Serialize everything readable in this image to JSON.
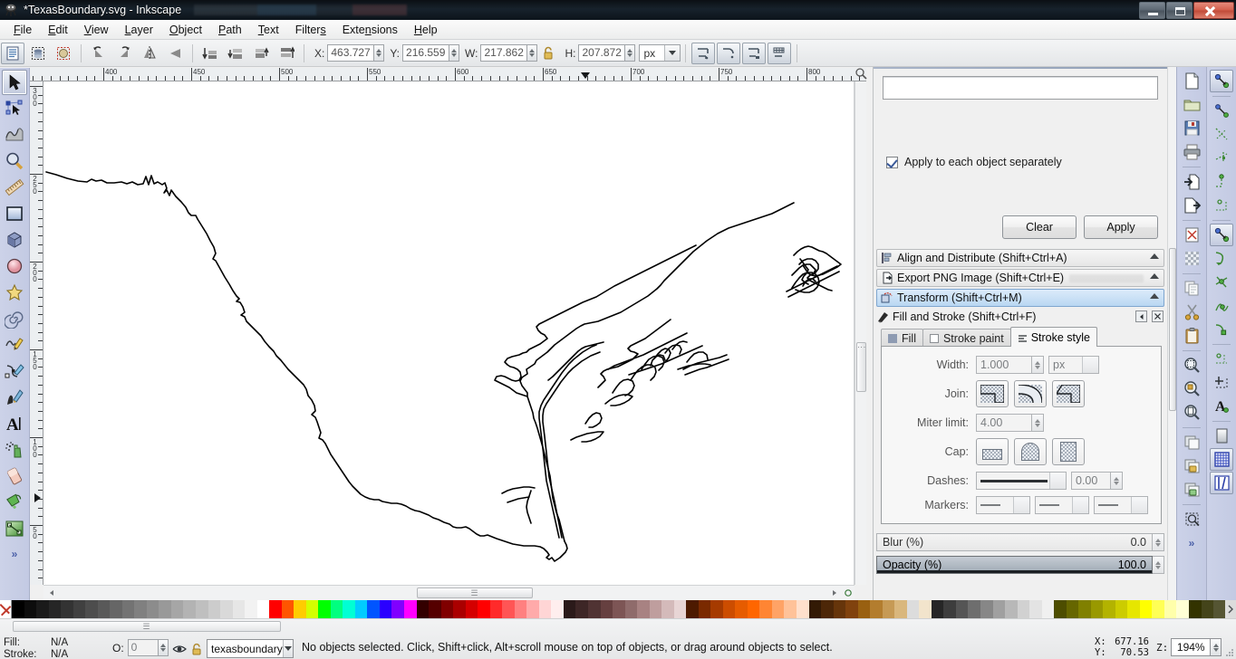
{
  "window": {
    "title": "*TexasBoundary.svg - Inkscape",
    "app_icon": "inkscape-logo-icon",
    "controls": {
      "minimize": "minimize-button",
      "restore": "restore-button",
      "close": "close-button"
    }
  },
  "menubar": {
    "items": [
      {
        "label": "File",
        "mnemonic": "F"
      },
      {
        "label": "Edit",
        "mnemonic": "E"
      },
      {
        "label": "View",
        "mnemonic": "V"
      },
      {
        "label": "Layer",
        "mnemonic": "L"
      },
      {
        "label": "Object",
        "mnemonic": "O"
      },
      {
        "label": "Path",
        "mnemonic": "P"
      },
      {
        "label": "Text",
        "mnemonic": "T"
      },
      {
        "label": "Filters",
        "mnemonic": "s"
      },
      {
        "label": "Extensions",
        "mnemonic": "n"
      },
      {
        "label": "Help",
        "mnemonic": "H"
      }
    ]
  },
  "selector_toolbar": {
    "buttons": [
      {
        "name": "select-all-icon",
        "title": "Select All"
      },
      {
        "name": "select-all-in-all-layers-icon",
        "title": "Select All in All Layers"
      },
      {
        "name": "deselect-icon",
        "title": "Deselect"
      },
      {
        "name": "rotate-ccw-icon",
        "title": "Rotate 90 CCW"
      },
      {
        "name": "rotate-cw-icon",
        "title": "Rotate 90 CW"
      },
      {
        "name": "flip-horizontal-icon",
        "title": "Flip Horizontal"
      },
      {
        "name": "flip-vertical-icon",
        "title": "Flip Vertical"
      },
      {
        "name": "lower-to-bottom-icon",
        "title": "Lower to Bottom"
      },
      {
        "name": "lower-one-step-icon",
        "title": "Lower One Step"
      },
      {
        "name": "raise-one-step-icon",
        "title": "Raise One Step"
      },
      {
        "name": "raise-to-top-icon",
        "title": "Raise to Top"
      }
    ],
    "x_label": "X:",
    "x_value": "463.727",
    "y_label": "Y:",
    "y_value": "216.559",
    "w_label": "W:",
    "w_value": "217.862",
    "h_label": "H:",
    "h_value": "207.872",
    "lock_icon": "lock-ratio-icon",
    "unit": "px",
    "affect_buttons": [
      {
        "name": "affect-stroke-width-icon"
      },
      {
        "name": "affect-rounded-corners-icon"
      },
      {
        "name": "affect-gradients-icon"
      },
      {
        "name": "affect-patterns-icon"
      }
    ]
  },
  "toolbox": {
    "tools": [
      {
        "name": "selector-tool",
        "label": "Selector",
        "active": true
      },
      {
        "name": "node-tool",
        "label": "Node editor",
        "active": false
      },
      {
        "name": "tweak-tool",
        "label": "Tweak",
        "active": false
      },
      {
        "name": "zoom-tool",
        "label": "Zoom",
        "active": false
      },
      {
        "name": "measure-tool",
        "label": "Measure",
        "active": false
      },
      {
        "name": "rectangle-tool",
        "label": "Rectangle",
        "active": false
      },
      {
        "name": "box3d-tool",
        "label": "3D Box",
        "active": false
      },
      {
        "name": "ellipse-tool",
        "label": "Ellipse",
        "active": false
      },
      {
        "name": "star-tool",
        "label": "Star",
        "active": false
      },
      {
        "name": "spiral-tool",
        "label": "Spiral",
        "active": false
      },
      {
        "name": "pencil-tool",
        "label": "Pencil",
        "active": false
      },
      {
        "name": "bezier-tool",
        "label": "Bezier",
        "active": false
      },
      {
        "name": "calligraphy-tool",
        "label": "Calligraphy",
        "active": false
      },
      {
        "name": "text-tool",
        "label": "Text",
        "active": false
      },
      {
        "name": "spray-tool",
        "label": "Spray",
        "active": false
      },
      {
        "name": "eraser-tool",
        "label": "Eraser",
        "active": false
      },
      {
        "name": "paint-bucket-tool",
        "label": "Paint Bucket",
        "active": false
      },
      {
        "name": "gradient-tool",
        "label": "Gradient",
        "active": false
      }
    ],
    "overflow_label": "»"
  },
  "rulers": {
    "unit": "px",
    "horizontal_labels": [
      "400",
      "450",
      "500",
      "550",
      "600",
      "650",
      "700",
      "750",
      "800"
    ],
    "vertical_labels": [
      "300",
      "250",
      "200",
      "150",
      "100",
      "50"
    ],
    "h_marker_value": "677",
    "v_marker_value": "70"
  },
  "canvas": {
    "document_name": "TexasBoundary.svg",
    "shape_name": "texas-boundary-path",
    "stroke_color": "#000000",
    "fill_color": "none",
    "background": "#ffffff"
  },
  "dock": {
    "transform_panel": {
      "apply_each_label": "Apply to each object separately",
      "apply_each_checked": true,
      "clear_label": "Clear",
      "apply_label": "Apply"
    },
    "collapsed_dialogs": [
      {
        "label": "Align and Distribute (Shift+Ctrl+A)",
        "icon": "align-icon",
        "active": false
      },
      {
        "label": "Export PNG Image (Shift+Ctrl+E)",
        "icon": "export-png-icon",
        "active": false
      },
      {
        "label": "Transform (Shift+Ctrl+M)",
        "icon": "transform-icon",
        "active": true
      }
    ],
    "fill_and_stroke": {
      "title": "Fill and Stroke (Shift+Ctrl+F)",
      "icon": "fill-stroke-icon",
      "dock_button": "dock-float-button",
      "close_button": "close-dialog-button",
      "tabs": [
        {
          "label": "Fill",
          "name": "tab-fill",
          "selected": false,
          "swatch": "#8e9bb2"
        },
        {
          "label": "Stroke paint",
          "name": "tab-stroke-paint",
          "selected": false,
          "swatch": "#ffffff"
        },
        {
          "label": "Stroke style",
          "name": "tab-stroke-style",
          "selected": true,
          "swatch": "lines"
        }
      ],
      "stroke_style": {
        "width_label": "Width:",
        "width_value": "1.000",
        "width_unit": "px",
        "join_label": "Join:",
        "join_options": [
          "miter-join",
          "round-join",
          "bevel-join"
        ],
        "miter_label": "Miter limit:",
        "miter_value": "4.00",
        "cap_label": "Cap:",
        "cap_options": [
          "butt-cap",
          "round-cap",
          "square-cap"
        ],
        "dashes_label": "Dashes:",
        "dashes_offset": "0.00",
        "markers_label": "Markers:",
        "markers": [
          "none",
          "none",
          "none"
        ]
      },
      "blur_label": "Blur (%)",
      "blur_value": "0.0",
      "opacity_label": "Opacity (%)",
      "opacity_value": "100.0"
    }
  },
  "commands_bar": {
    "buttons": [
      {
        "name": "new-document-icon"
      },
      {
        "name": "open-document-icon"
      },
      {
        "name": "save-document-icon"
      },
      {
        "name": "print-document-icon"
      },
      {
        "name": "import-icon"
      },
      {
        "name": "export-icon"
      },
      {
        "name": "undo-history-icon"
      },
      {
        "name": "paste-in-place-icon"
      },
      {
        "name": "duplicate-icon"
      },
      {
        "name": "cut-icon"
      },
      {
        "name": "clipboard-icon"
      },
      {
        "name": "zoom-selection-icon"
      },
      {
        "name": "zoom-drawing-icon"
      },
      {
        "name": "zoom-page-icon"
      },
      {
        "name": "duplicate-object-icon"
      },
      {
        "name": "group-icon"
      },
      {
        "name": "ungroup-icon"
      },
      {
        "name": "object-properties-icon"
      }
    ],
    "overflow_label": "»"
  },
  "snap_bar": {
    "buttons": [
      {
        "name": "enable-snapping-icon",
        "active": true
      },
      {
        "name": "snap-bounding-box-icon",
        "active": false
      },
      {
        "name": "snap-bbox-edges-icon",
        "active": false
      },
      {
        "name": "snap-bbox-corners-icon",
        "active": false
      },
      {
        "name": "snap-bbox-edge-midpoints-icon",
        "active": false
      },
      {
        "name": "snap-bbox-centers-icon",
        "active": false
      },
      {
        "name": "snap-nodes-paths-icon",
        "active": true
      },
      {
        "name": "snap-paths-icon",
        "active": false
      },
      {
        "name": "snap-path-intersections-icon",
        "active": false
      },
      {
        "name": "snap-cusp-nodes-icon",
        "active": false
      },
      {
        "name": "snap-smooth-nodes-icon",
        "active": false
      },
      {
        "name": "snap-midpoints-icon",
        "active": false
      },
      {
        "name": "snap-text-baseline-icon",
        "active": false
      },
      {
        "name": "snap-page-border-icon",
        "active": false
      },
      {
        "name": "snap-grid-icon",
        "active": true
      },
      {
        "name": "snap-guides-icon",
        "active": true
      }
    ]
  },
  "palette": {
    "name": "inkscape-default-palette",
    "remove_color_label": "remove-color-swatch",
    "colors": [
      "#000000",
      "#0d0d0d",
      "#1a1a1a",
      "#262626",
      "#333333",
      "#404040",
      "#4d4d4d",
      "#595959",
      "#666666",
      "#737373",
      "#808080",
      "#8c8c8c",
      "#999999",
      "#a6a6a6",
      "#b3b3b3",
      "#bfbfbf",
      "#cccccc",
      "#d9d9d9",
      "#e6e6e6",
      "#f2f2f2",
      "#ffffff",
      "#ff0000",
      "#ff5500",
      "#ffcc00",
      "#d4ff00",
      "#00ff00",
      "#00ff7f",
      "#00ffd4",
      "#00ccff",
      "#0055ff",
      "#2a00ff",
      "#8000ff",
      "#ff00ff",
      "#330000",
      "#550000",
      "#800000",
      "#aa0000",
      "#d40000",
      "#ff0000",
      "#ff2a2a",
      "#ff5555",
      "#ff8080",
      "#ffaaaa",
      "#ffd5d5",
      "#ffeeee",
      "#2b1a1a",
      "#3d2626",
      "#503333",
      "#664040",
      "#7d5555",
      "#8f6b6b",
      "#a88282",
      "#bf9e9e",
      "#d4baba",
      "#e8d5d5",
      "#4d1a00",
      "#7a2a00",
      "#a63b00",
      "#cc4d00",
      "#e65c00",
      "#ff6600",
      "#ff8533",
      "#ffa366",
      "#ffc299",
      "#ffe0cc",
      "#331a05",
      "#4d2708",
      "#66350b",
      "#80420e",
      "#996011",
      "#b37d2e",
      "#c69a55",
      "#d9b77d",
      "#e6ceа4",
      "#f2e4cc",
      "#262626",
      "#3d3d3d",
      "#555555",
      "#6e6e6e",
      "#878787",
      "#a0a0a0",
      "#b8b8b8",
      "#d1d1d1",
      "#e3e3e3",
      "#f0f0f0",
      "#4d4d00",
      "#666600",
      "#808000",
      "#999900",
      "#b3b300",
      "#cccc00",
      "#e6e600",
      "#ffff00",
      "#ffff55",
      "#ffffaa",
      "#ffffd5",
      "#333300",
      "#44441a",
      "#555533"
    ]
  },
  "statusbar": {
    "fill_label": "Fill:",
    "fill_value": "N/A",
    "stroke_label": "Stroke:",
    "stroke_value": "N/A",
    "opacity_label": "O:",
    "opacity_value": "0",
    "eye_icon": "layer-visibility-icon",
    "lock_icon": "layer-lock-icon",
    "layer_name": "texasboundary",
    "message": "No objects selected. Click, Shift+click, Alt+scroll mouse on top of objects, or drag around objects to select.",
    "pointer_x_label": "X:",
    "pointer_x": "677.16",
    "pointer_y_label": "Y:",
    "pointer_y": "70.53",
    "zoom_label": "Z:",
    "zoom_value": "194%"
  }
}
